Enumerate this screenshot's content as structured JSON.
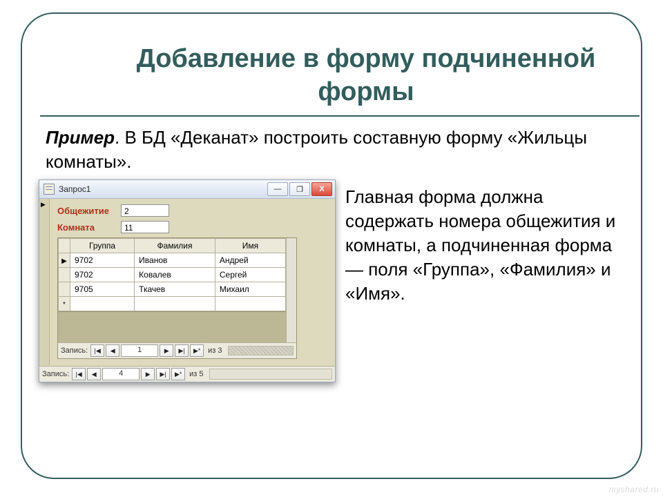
{
  "title": "Добавление в форму подчиненной формы",
  "example_label": "Пример",
  "example_text": ". В БД «Деканат» построить составную форму «Жильцы комнаты».",
  "desc": "Главная форма должна содержать номера общежития и комнаты, а подчиненная форма — поля  «Группа», «Фамилия» и «Имя».",
  "watermark": "myshared.ru",
  "window": {
    "title": "Запрос1",
    "buttons": {
      "min": "—",
      "max": "❐",
      "close": "X"
    }
  },
  "fields": {
    "dorm_label": "Общежитие",
    "dorm_value": "2",
    "room_label": "Комната",
    "room_value": "11"
  },
  "subform": {
    "headers": [
      "Группа",
      "Фамилия",
      "Имя"
    ],
    "rows": [
      {
        "mark": "▶",
        "cells": [
          "9702",
          "Иванов",
          "Андрей"
        ]
      },
      {
        "mark": "",
        "cells": [
          "9702",
          "Ковалев",
          "Сергей"
        ]
      },
      {
        "mark": "",
        "cells": [
          "9705",
          "Ткачев",
          "Михаил"
        ]
      },
      {
        "mark": "*",
        "cells": [
          "",
          "",
          ""
        ]
      }
    ],
    "nav": {
      "label": "Запись:",
      "value": "1",
      "of_label": "из",
      "of_value": "3"
    }
  },
  "outer_nav": {
    "label": "Запись:",
    "value": "4",
    "of_label": "из",
    "of_value": "5"
  },
  "nav_glyphs": {
    "first": "|◀",
    "prev": "◀",
    "next": "▶",
    "last": "▶|",
    "new": "▶*"
  }
}
